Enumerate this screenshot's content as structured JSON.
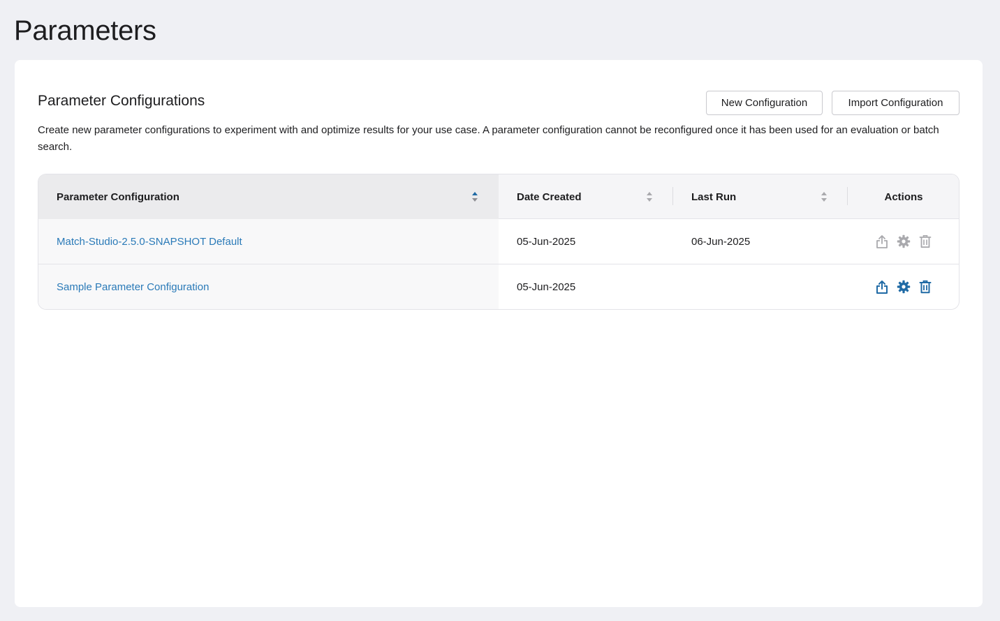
{
  "page": {
    "title": "Parameters"
  },
  "section": {
    "title": "Parameter Configurations",
    "description": "Create new parameter configurations to experiment with and optimize results for your use case. A parameter configuration cannot be reconfigured once it has been used for an evaluation or batch search."
  },
  "toolbar": {
    "new_label": "New Configuration",
    "import_label": "Import Configuration"
  },
  "table": {
    "columns": [
      "Parameter Configuration",
      "Date Created",
      "Last Run",
      "Actions"
    ],
    "sort": {
      "column": "Parameter Configuration",
      "direction": "ascending"
    },
    "rows": [
      {
        "name": "Match-Studio-2.5.0-SNAPSHOT Default",
        "date_created": "05-Jun-2025",
        "last_run": "06-Jun-2025",
        "actions": [
          "export-icon",
          "gear-icon",
          "trash-icon"
        ],
        "actions_enabled": false
      },
      {
        "name": "Sample Parameter Configuration",
        "date_created": "05-Jun-2025",
        "last_run": "",
        "actions": [
          "export-icon",
          "gear-icon",
          "trash-icon"
        ],
        "actions_enabled": true
      }
    ]
  },
  "colors": {
    "accent": "#1f6aa5",
    "link": "#2a7ab8",
    "disabled_icon": "#a9a9ad",
    "background": "#eff0f4"
  }
}
